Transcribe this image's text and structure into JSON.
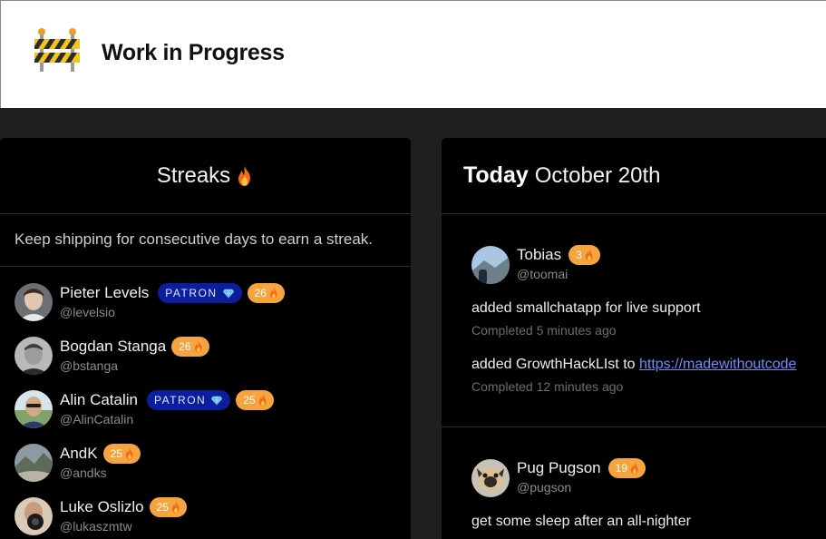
{
  "site": {
    "title": "Work in Progress",
    "logo_icon": "construction-barrier-icon"
  },
  "streaks": {
    "title": "Streaks",
    "intro": "Keep shipping for consecutive days to earn a streak.",
    "users": [
      {
        "name": "Pieter Levels",
        "handle": "@levelsio",
        "patron": true,
        "streak": "26"
      },
      {
        "name": "Bogdan Stanga",
        "handle": "@bstanga",
        "patron": false,
        "streak": "26"
      },
      {
        "name": "Alin Catalin",
        "handle": "@AlinCatalin",
        "patron": true,
        "streak": "25"
      },
      {
        "name": "AndK",
        "handle": "@andks",
        "patron": false,
        "streak": "25"
      },
      {
        "name": "Luke Oslizlo",
        "handle": "@lukaszmtw",
        "patron": false,
        "streak": "25"
      }
    ],
    "patron_label": "PATRON"
  },
  "feed": {
    "today_label": "Today",
    "date": "October 20th",
    "entries": [
      {
        "name": "Tobias",
        "handle": "@toomai",
        "streak": "3",
        "tasks": [
          {
            "text": "added smallchatapp for live support",
            "completed": "Completed 5 minutes ago"
          },
          {
            "text": "added GrowthHackLIst to ",
            "link": "https://madewithoutcode",
            "completed": "Completed 12 minutes ago"
          }
        ]
      },
      {
        "name": "Pug Pugson",
        "handle": "@pugson",
        "streak": "19",
        "tasks": [
          {
            "text": "get some sleep after an all-nighter"
          }
        ]
      }
    ]
  },
  "colors": {
    "accent_orange": "#f5a43f",
    "patron_blue": "#0b1f9e",
    "link": "#6a8dff"
  }
}
